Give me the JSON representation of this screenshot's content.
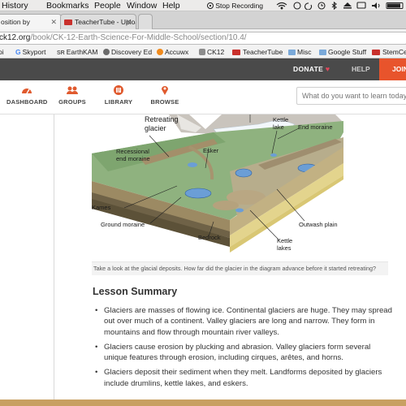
{
  "menubar": {
    "items": [
      "History",
      "Bookmarks",
      "People",
      "Window",
      "Help"
    ],
    "stop_recording": "Stop Recording"
  },
  "tabs": [
    {
      "label": "osition by",
      "active": true
    },
    {
      "label": "TeacherTube - Upload",
      "active": false
    }
  ],
  "address_bar": {
    "host": "ck12.org",
    "path": "/book/CK-12-Earth-Science-For-Middle-School/section/10.4/"
  },
  "bookmarks": [
    {
      "label": "oi",
      "icon": "cut-off-icon"
    },
    {
      "label": "Skyport",
      "icon": "google-icon"
    },
    {
      "label": "EarthKAM",
      "icon": "earthkam-icon"
    },
    {
      "label": "Discovery Ed",
      "icon": "discovery-icon"
    },
    {
      "label": "Accuwx",
      "icon": "accuweather-icon"
    },
    {
      "label": "CK12",
      "icon": "ck12-icon"
    },
    {
      "label": "TeacherTube",
      "icon": "teachertube-icon"
    },
    {
      "label": "Misc",
      "icon": "folder-icon"
    },
    {
      "label": "Google Stuff",
      "icon": "folder-icon"
    },
    {
      "label": "StemCell",
      "icon": "stemcell-icon"
    }
  ],
  "site_header": {
    "donate": "DONATE",
    "help": "HELP",
    "join": "JOIN"
  },
  "site_nav": {
    "items": [
      {
        "label": "DASHBOARD",
        "icon": "dashboard-icon"
      },
      {
        "label": "GROUPS",
        "icon": "groups-icon"
      },
      {
        "label": "LIBRARY",
        "icon": "library-icon"
      },
      {
        "label": "BROWSE",
        "icon": "browse-pin-icon"
      }
    ],
    "search_placeholder": "What do you want to learn today?"
  },
  "figure": {
    "labels": {
      "retreating_glacier": "Retreating\nglacier",
      "kettle_lake": "Kettle\nlake",
      "end_moraine": "End moraine",
      "recessional": "Recessional\nend moraine",
      "esker": "Esker",
      "kames": "Kames",
      "ground_moraine": "Ground moraine",
      "outwash_plain": "Outwash plain",
      "bedrock": "Bedrock",
      "kettle_lakes": "Kettle\nlakes"
    },
    "caption": "Take a look at the glacial deposits. How far did the glacier in the diagram advance before it started retreating?"
  },
  "lesson_summary": {
    "title": "Lesson Summary",
    "bullets": [
      "Glaciers are masses of flowing ice. Continental glaciers are huge. They may spread out over much of a continent. Valley glaciers are long and narrow. They form in mountains and flow through mountain river valleys.",
      "Glaciers cause erosion by plucking and abrasion. Valley glaciers form several unique features through erosion, including cirques, arêtes, and horns.",
      "Glaciers deposit their sediment when they melt. Landforms deposited by glaciers include drumlins, kettle lakes, and eskers."
    ]
  },
  "colors": {
    "topbar": "#4a4a4a",
    "join_accent": "#e8542c",
    "heart": "#e0475b",
    "nav_icon": "#e05a2e"
  }
}
